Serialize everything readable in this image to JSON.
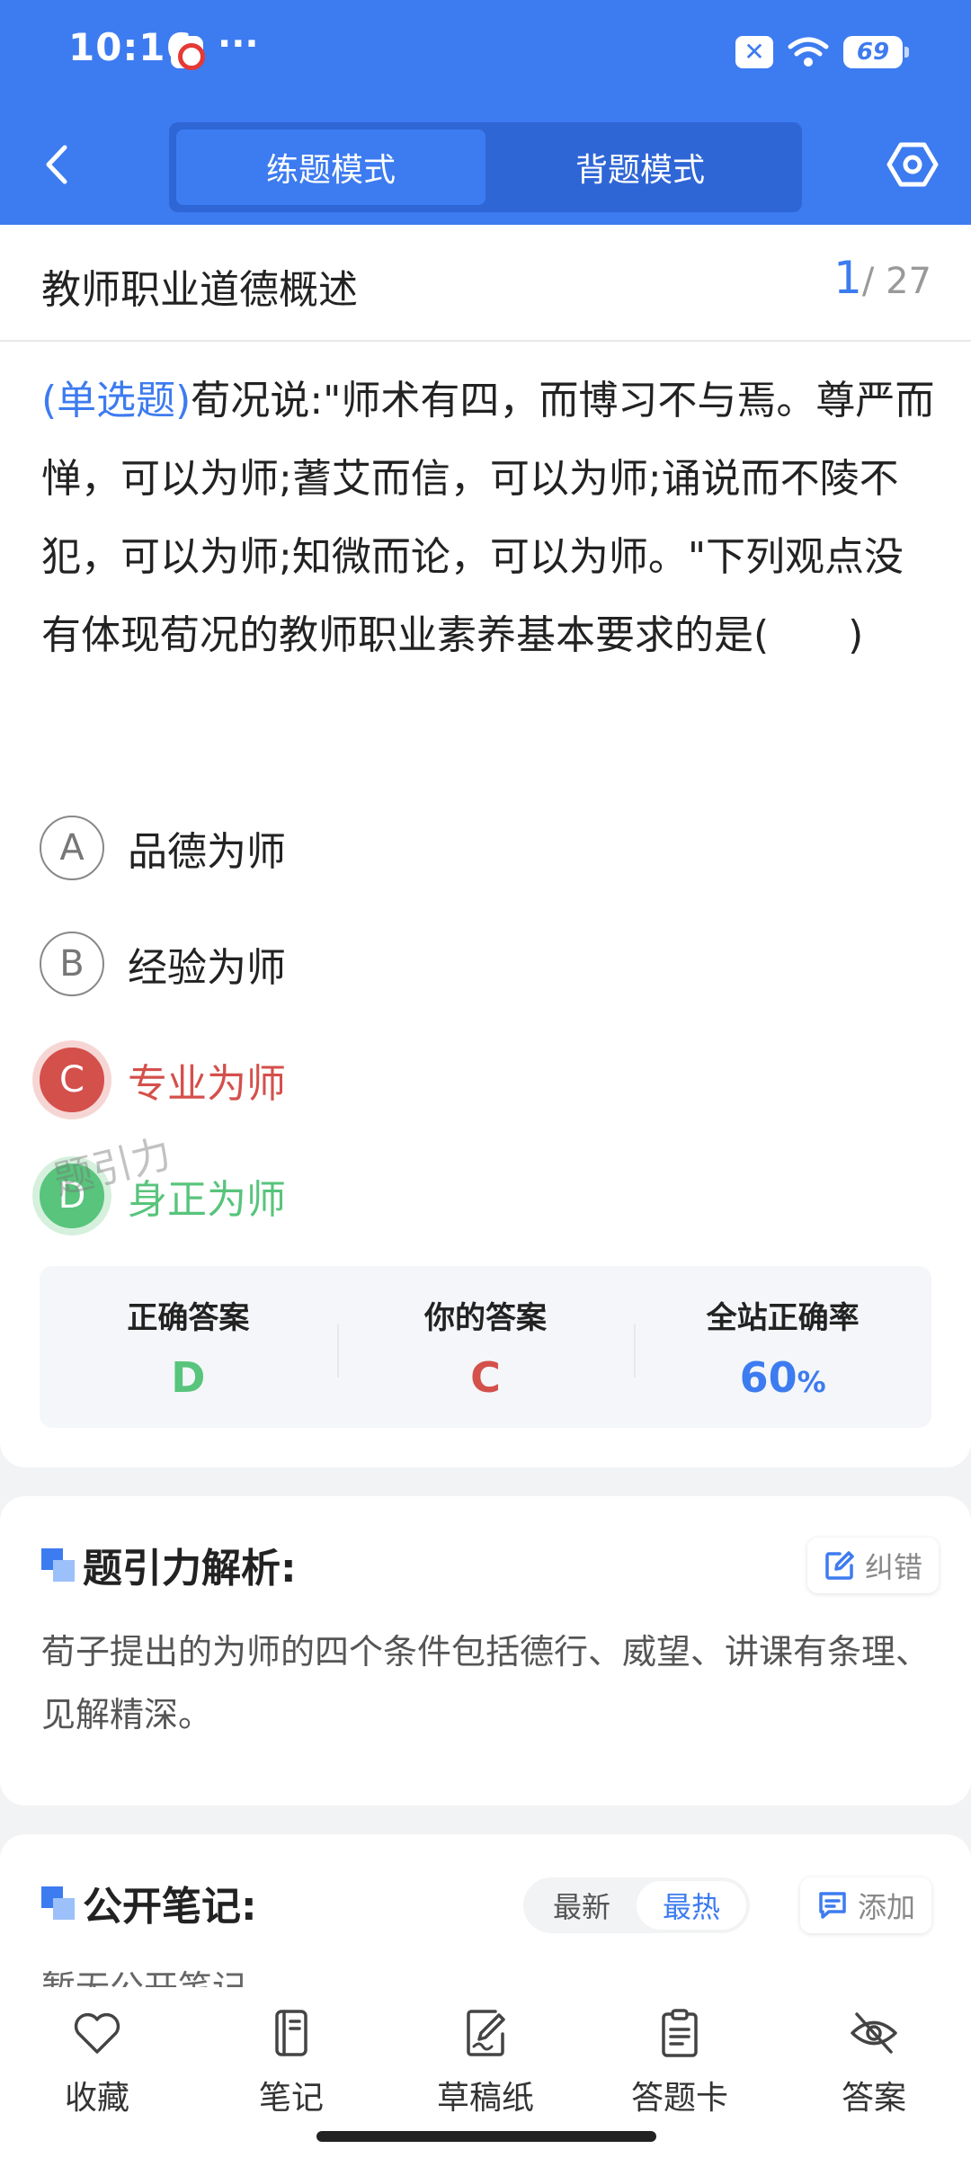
{
  "status_bar": {
    "time": "10:16",
    "dots": "···",
    "battery": "69"
  },
  "header": {
    "tabs": [
      {
        "label": "练题模式",
        "active": true
      },
      {
        "label": "背题模式",
        "active": false
      }
    ]
  },
  "question": {
    "chapter": "教师职业道德概述",
    "current": "1",
    "total": "/ 27",
    "type": "(单选题)",
    "text": "荀况说:\"师术有四，而博习不与焉。尊严而惮，可以为师;蓍艾而信，可以为师;诵说而不陵不犯，可以为师;知微而论，可以为师。\"下列观点没有体现荀况的教师职业素养基本要求的是(　　)",
    "options": [
      {
        "letter": "A",
        "text": "品德为师",
        "state": "normal"
      },
      {
        "letter": "B",
        "text": "经验为师",
        "state": "normal"
      },
      {
        "letter": "C",
        "text": "专业为师",
        "state": "wrong"
      },
      {
        "letter": "D",
        "text": "身正为师",
        "state": "right"
      }
    ],
    "watermark": "题引力"
  },
  "result": {
    "correct_label": "正确答案",
    "correct_value": "D",
    "yours_label": "你的答案",
    "yours_value": "C",
    "rate_label": "全站正确率",
    "rate_value": "60",
    "rate_unit": "%"
  },
  "analysis": {
    "title": "题引力解析:",
    "report_label": "纠错",
    "text": "荀子提出的为师的四个条件包括德行、威望、讲课有条理、见解精深。"
  },
  "notes": {
    "title": "公开笔记:",
    "sort_latest": "最新",
    "sort_hot": "最热",
    "add_label": "添加",
    "empty_text": "暂无公开笔记"
  },
  "bottom_nav": [
    {
      "label": "收藏",
      "icon": "heart-icon"
    },
    {
      "label": "笔记",
      "icon": "notebook-icon"
    },
    {
      "label": "草稿纸",
      "icon": "draft-icon"
    },
    {
      "label": "答题卡",
      "icon": "clipboard-icon"
    },
    {
      "label": "答案",
      "icon": "eye-off-icon"
    }
  ],
  "colors": {
    "primary": "#3d7bf0",
    "wrong": "#d4504b",
    "right": "#58c47c"
  }
}
